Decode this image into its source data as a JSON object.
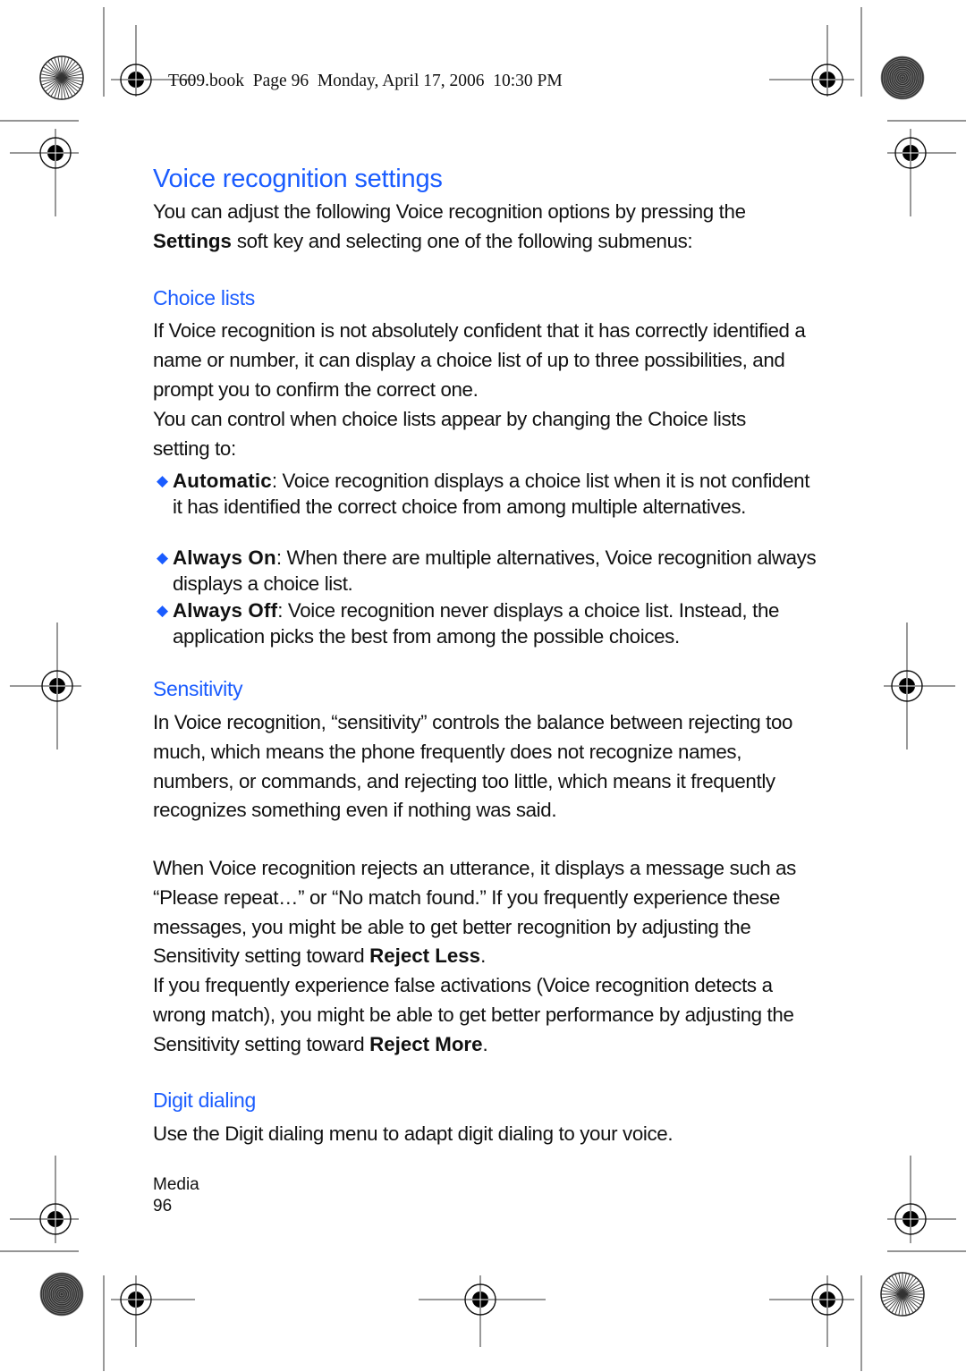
{
  "header": {
    "print_line": "T609.book  Page 96  Monday, April 17, 2006  10:30 PM"
  },
  "page": {
    "title": "Voice recognition settings",
    "intro": {
      "before": "You can adjust the following Voice recognition options by pressing the ",
      "bold": "Settings",
      "after": " soft key and selecting one of the following submenus:"
    },
    "sections": {
      "choice_lists": {
        "heading": "Choice lists",
        "para1": "If Voice recognition is not absolutely confident that it has correctly identified a name or number, it can display a choice list of up to three possibilities, and prompt you to confirm the correct one.",
        "para2": "You can control when choice lists appear by changing the Choice lists setting to:",
        "options": [
          {
            "label": "Automatic",
            "text": ": Voice recognition displays a choice list when it is not confident it has identified the correct choice from among multiple alternatives."
          },
          {
            "label": "Always On",
            "text": ": When there are multiple alternatives, Voice recognition always displays a choice list."
          },
          {
            "label": "Always Off",
            "text": ": Voice recognition never displays a choice list. Instead, the application picks the best from among the possible choices."
          }
        ]
      },
      "sensitivity": {
        "heading": "Sensitivity",
        "para1": "In Voice recognition, “sensitivity” controls the balance between rejecting too much, which means the phone frequently does not recognize names, numbers, or commands, and rejecting too little, which means it frequently recognizes something even if nothing was said.",
        "para2_before": "When Voice recognition rejects an utterance, it displays a message such as “Please repeat…” or “No match found.” If you frequently experience these messages, you might be able to get better recognition by adjusting the Sensitivity setting toward ",
        "para2_bold": "Reject Less",
        "para2_after": ".",
        "para3_before": "If you frequently experience false activations (Voice recognition detects a wrong match), you might be able to get better performance by adjusting the Sensitivity setting toward ",
        "para3_bold": "Reject More",
        "para3_after": "."
      },
      "digit_dialing": {
        "heading": "Digit dialing",
        "para1": "Use the Digit dialing menu to adapt digit dialing to your voice."
      }
    },
    "footer": {
      "section": "Media",
      "page_number": "96"
    }
  },
  "colors": {
    "heading": "#1a5cff",
    "bullet": "#1a5cff",
    "text": "#111111"
  }
}
